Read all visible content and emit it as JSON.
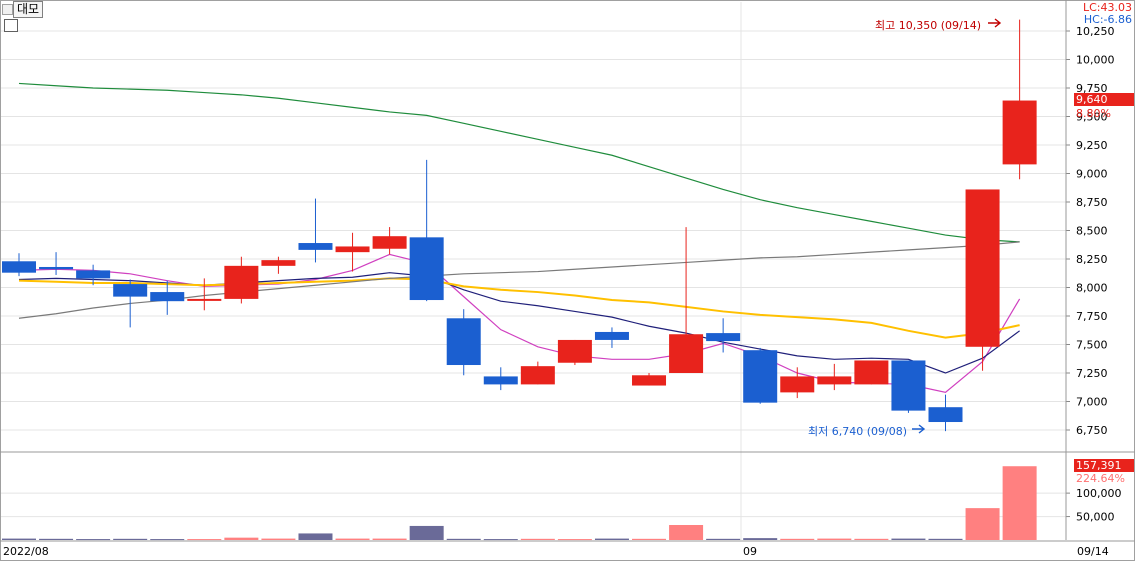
{
  "toolbar": {
    "mode_label": "대모"
  },
  "indicators": {
    "lc": "LC:43.03",
    "hc": "HC:-6.86"
  },
  "annotations": {
    "high": "최고 10,350 (09/14)",
    "low": "최저 6,740 (09/08)"
  },
  "price_badge": {
    "price": "9,640",
    "change_pct": "8.80%"
  },
  "volume_badge": {
    "volume": "157,391",
    "change_pct": "224.64%"
  },
  "x_labels": {
    "start": "2022/08",
    "month": "09",
    "end": "09/14"
  },
  "colors": {
    "up": "#e8231c",
    "down": "#1b5fd0",
    "up_vol": "#ff8080",
    "down_vol": "#6a6a98",
    "ma_magenta": "#d040c0",
    "ma_navy": "#20207a",
    "ma_gold": "#ffc000",
    "ma_green": "#1f8c3c",
    "ma_gray": "#7a7a7a"
  },
  "chart_data": {
    "type": "candlestick",
    "price_axis": {
      "min": 6750,
      "max": 10250,
      "step": 250,
      "ticks": [
        "10,250",
        "10,000",
        "9,750",
        "9,500",
        "9,250",
        "9,000",
        "8,750",
        "8,500",
        "8,250",
        "8,000",
        "7,750",
        "7,500",
        "7,250",
        "7,000",
        "6,750"
      ]
    },
    "volume_axis": {
      "ticks": [
        "100,000",
        "50,000"
      ]
    },
    "candles": [
      {
        "o": 8230,
        "h": 8300,
        "l": 8100,
        "c": 8130
      },
      {
        "o": 8180,
        "h": 8310,
        "l": 8110,
        "c": 8160
      },
      {
        "o": 8150,
        "h": 8200,
        "l": 8020,
        "c": 8080
      },
      {
        "o": 8030,
        "h": 8070,
        "l": 7650,
        "c": 7920
      },
      {
        "o": 7960,
        "h": 8060,
        "l": 7760,
        "c": 7880
      },
      {
        "o": 7900,
        "h": 8080,
        "l": 7800,
        "c": 7900
      },
      {
        "o": 7900,
        "h": 8270,
        "l": 7860,
        "c": 8190
      },
      {
        "o": 8190,
        "h": 8270,
        "l": 8120,
        "c": 8240
      },
      {
        "o": 8390,
        "h": 8780,
        "l": 8220,
        "c": 8330
      },
      {
        "o": 8310,
        "h": 8480,
        "l": 8140,
        "c": 8360
      },
      {
        "o": 8340,
        "h": 8530,
        "l": 8290,
        "c": 8450
      },
      {
        "o": 8440,
        "h": 9120,
        "l": 7880,
        "c": 7890
      },
      {
        "o": 7730,
        "h": 7810,
        "l": 7230,
        "c": 7320
      },
      {
        "o": 7220,
        "h": 7300,
        "l": 7100,
        "c": 7150
      },
      {
        "o": 7150,
        "h": 7350,
        "l": 7150,
        "c": 7310
      },
      {
        "o": 7340,
        "h": 7540,
        "l": 7320,
        "c": 7540
      },
      {
        "o": 7610,
        "h": 7650,
        "l": 7470,
        "c": 7540
      },
      {
        "o": 7140,
        "h": 7250,
        "l": 7140,
        "c": 7230
      },
      {
        "o": 7250,
        "h": 8530,
        "l": 7250,
        "c": 7590
      },
      {
        "o": 7600,
        "h": 7730,
        "l": 7430,
        "c": 7530
      },
      {
        "o": 7450,
        "h": 7470,
        "l": 6980,
        "c": 6990
      },
      {
        "o": 7080,
        "h": 7300,
        "l": 7030,
        "c": 7220
      },
      {
        "o": 7150,
        "h": 7330,
        "l": 7100,
        "c": 7220
      },
      {
        "o": 7150,
        "h": 7350,
        "l": 7150,
        "c": 7360
      },
      {
        "o": 7360,
        "h": 7360,
        "l": 6900,
        "c": 6920
      },
      {
        "o": 6950,
        "h": 7060,
        "l": 6740,
        "c": 6820
      },
      {
        "o": 7480,
        "h": 8860,
        "l": 7270,
        "c": 8860
      },
      {
        "o": 9080,
        "h": 10350,
        "l": 8950,
        "c": 9640
      }
    ],
    "volumes": [
      3000,
      2500,
      2000,
      2500,
      2000,
      2000,
      5000,
      3000,
      14000,
      3000,
      3000,
      30000,
      2500,
      2000,
      2500,
      2000,
      3000,
      2500,
      32000,
      2500,
      4000,
      2500,
      3000,
      2500,
      3000,
      2500,
      68000,
      157391
    ],
    "moving_averages": [
      {
        "color": "#d040c0",
        "values": [
          8150,
          8160,
          8150,
          8120,
          8060,
          8010,
          8020,
          8030,
          8070,
          8150,
          8290,
          8210,
          7920,
          7630,
          7480,
          7400,
          7370,
          7370,
          7420,
          7510,
          7400,
          7250,
          7170,
          7160,
          7150,
          7080,
          7350,
          7900
        ]
      },
      {
        "color": "#20207a",
        "values": [
          8070,
          8080,
          8070,
          8060,
          8040,
          8020,
          8040,
          8060,
          8080,
          8090,
          8130,
          8100,
          7980,
          7880,
          7840,
          7790,
          7740,
          7660,
          7600,
          7520,
          7460,
          7400,
          7370,
          7380,
          7370,
          7250,
          7380,
          7620
        ]
      },
      {
        "color": "#ffc000",
        "values": [
          8060,
          8050,
          8040,
          8040,
          8030,
          8020,
          8030,
          8040,
          8050,
          8060,
          8080,
          8070,
          8010,
          7980,
          7960,
          7930,
          7890,
          7870,
          7830,
          7790,
          7760,
          7740,
          7720,
          7690,
          7620,
          7560,
          7600,
          7670
        ]
      },
      {
        "color": "#1f8c3c",
        "values": [
          9790,
          9770,
          9750,
          9740,
          9730,
          9710,
          9690,
          9660,
          9620,
          9580,
          9540,
          9510,
          9440,
          9370,
          9300,
          9230,
          9160,
          9060,
          8960,
          8860,
          8770,
          8700,
          8640,
          8580,
          8520,
          8460,
          8420,
          8400
        ]
      },
      {
        "color": "#7a7a7a",
        "values": [
          7730,
          7770,
          7820,
          7860,
          7890,
          7930,
          7960,
          7990,
          8020,
          8050,
          8080,
          8100,
          8120,
          8130,
          8140,
          8160,
          8180,
          8200,
          8220,
          8240,
          8260,
          8270,
          8290,
          8310,
          8330,
          8350,
          8370,
          8400
        ]
      }
    ]
  }
}
